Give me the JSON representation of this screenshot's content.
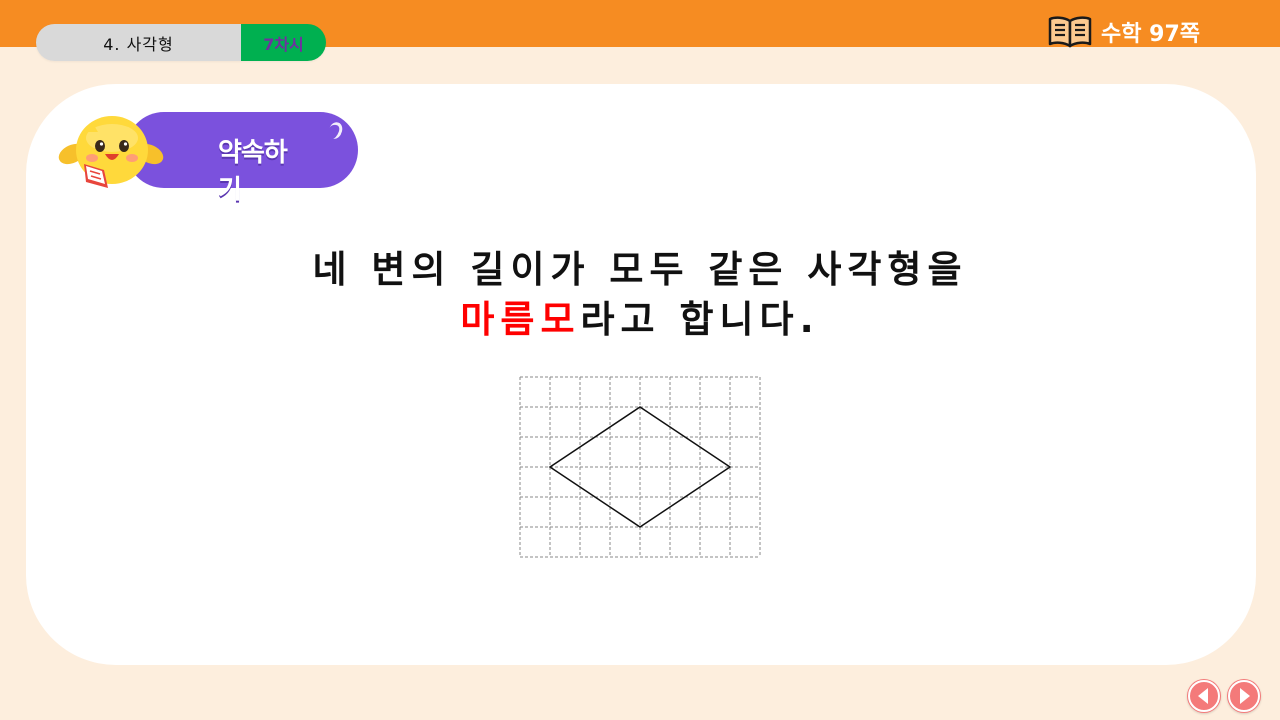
{
  "header": {
    "chapter": "4. 사각형",
    "lesson": "7차시",
    "book_icon": "open-book-icon",
    "textbook_ref": "수학 97쪽"
  },
  "badge": {
    "label": "약속하기",
    "mascot_icon": "chick-mascot-icon"
  },
  "definition": {
    "line1": "네 변의 길이가 모두 같은 사각형을",
    "term": "마름모",
    "line2_rest": "라고 합니다."
  },
  "figure": {
    "grid_columns": 8,
    "grid_rows": 6,
    "rhombus_vertices": [
      [
        4,
        1
      ],
      [
        7,
        3
      ],
      [
        4,
        5
      ],
      [
        1,
        3
      ]
    ]
  },
  "nav": {
    "prev_icon": "prev-arrow-icon",
    "next_icon": "next-arrow-icon"
  },
  "colors": {
    "topbar": "#f68c22",
    "background": "#fdeedd",
    "lesson_badge": "#00b050",
    "lesson_text": "#7030a0",
    "badge_pill": "#7b51dd",
    "term": "#ff0000",
    "nav_button": "#f47a7a"
  }
}
